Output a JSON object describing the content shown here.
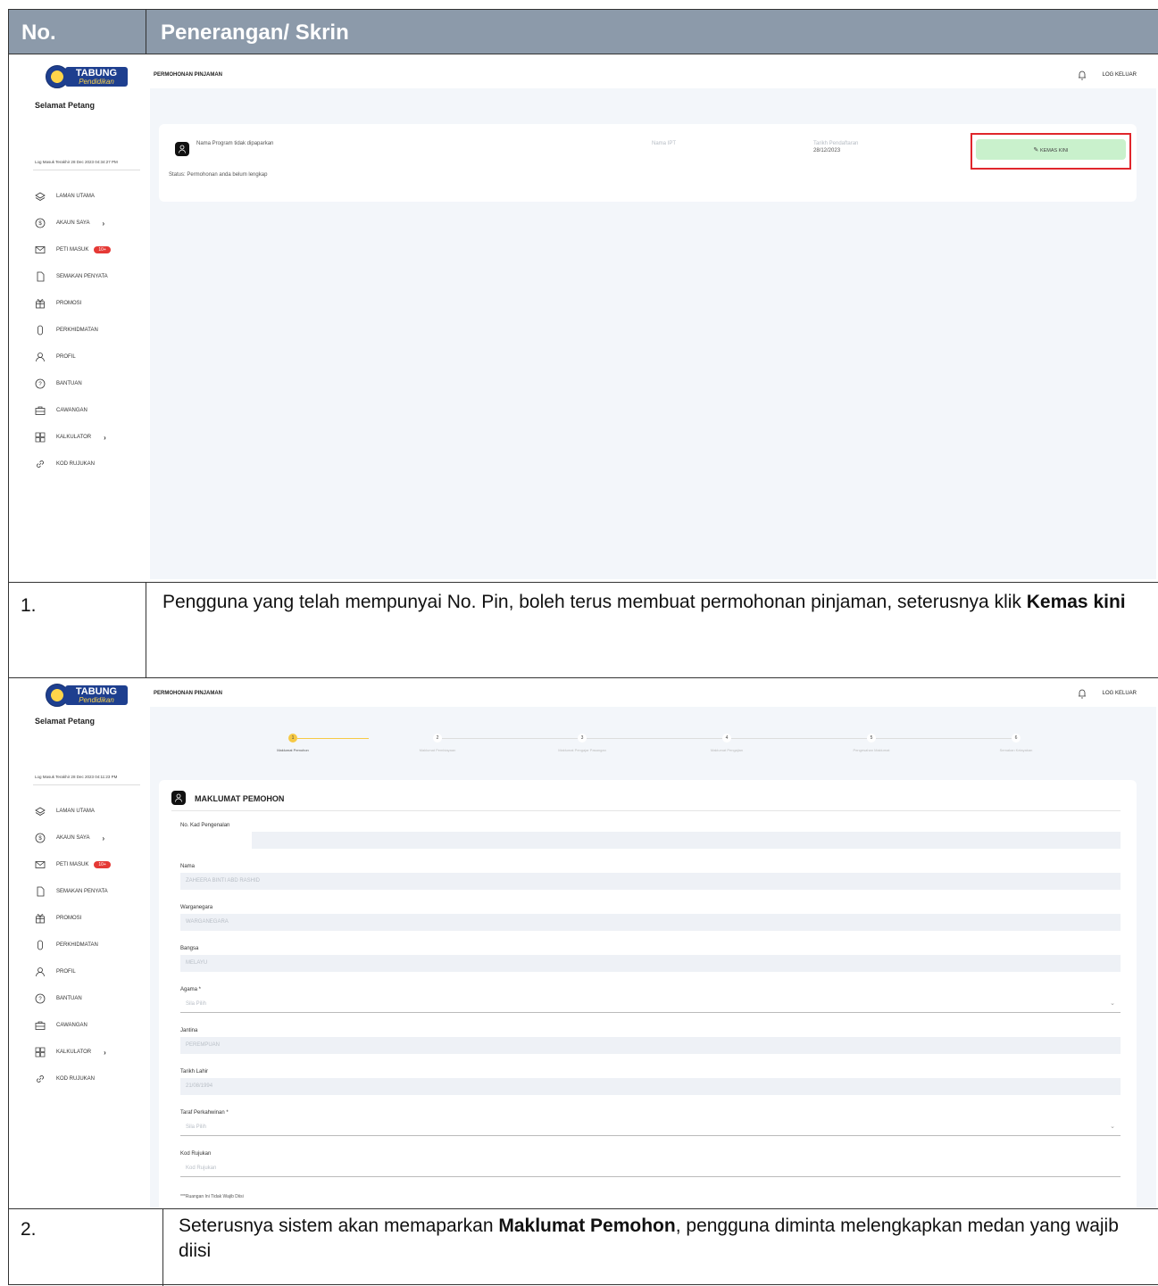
{
  "header": {
    "col1": "No.",
    "col2": "Penerangan/ Skrin"
  },
  "app": {
    "logo_top": "TABUNG",
    "logo_bottom": "Pendidikan",
    "greeting": "Selamat Petang",
    "page_title": "PERMOHONAN PINJAMAN",
    "logout": "LOG KELUAR",
    "nav": [
      {
        "label": "LAMAN UTAMA",
        "icon": "layers-icon"
      },
      {
        "label": "AKAUN SAYA",
        "icon": "dollar-circle-icon",
        "chevron": "›"
      },
      {
        "label": "PETI MASUK",
        "icon": "mail-icon",
        "badge": "10+"
      },
      {
        "label": "SEMAKAN PENYATA",
        "icon": "document-icon"
      },
      {
        "label": "PROMOSI",
        "icon": "gift-icon"
      },
      {
        "label": "PERKHIDMATAN",
        "icon": "mouse-icon"
      },
      {
        "label": "PROFIL",
        "icon": "user-icon"
      },
      {
        "label": "BANTUAN",
        "icon": "help-circle-icon"
      },
      {
        "label": "CAWANGAN",
        "icon": "briefcase-icon"
      },
      {
        "label": "KALKULATOR",
        "icon": "calculator-icon",
        "chevron": "›"
      },
      {
        "label": "KOD RUJUKAN",
        "icon": "link-icon"
      }
    ]
  },
  "shot1": {
    "last_login": "Log Masuk Terakhir 28 Dec 2023 04:34:27 PM",
    "program": "Nama Program tidak dipaparkan",
    "ipt": "Nama IPT",
    "date_label": "Tarikh Pendaftaran",
    "date_value": "28/12/2023",
    "button": "KEMAS KINI",
    "status": "Status: Permohonan anda belum lengkap"
  },
  "row1": {
    "num": "1.",
    "text_a": "Pengguna yang telah mempunyai No. Pin, boleh terus membuat permohonan pinjaman, seterusnya klik ",
    "text_bold": "Kemas kini"
  },
  "shot2": {
    "last_login": "Log Masuk Terakhir 28 Dec 2023 04:11:23 PM",
    "steps": [
      {
        "n": "1",
        "label": "Maklumat Pemohon"
      },
      {
        "n": "2",
        "label": "Maklumat Pembiayaan"
      },
      {
        "n": "3",
        "label": "Maklumat Pengajar Pasangan"
      },
      {
        "n": "4",
        "label": "Maklumat Pengajian"
      },
      {
        "n": "5",
        "label": "Pengesahan Maklumat"
      },
      {
        "n": "6",
        "label": "Semakan Kelayakan"
      }
    ],
    "section_title": "MAKLUMAT PEMOHON",
    "fields": [
      {
        "label": "No. Kad Pengenalan",
        "value": ""
      },
      {
        "label": "Nama",
        "value": "ZAHEERA BINTI ABD RASHID"
      },
      {
        "label": "Warganegara",
        "value": "WARGANEGARA"
      },
      {
        "label": "Bangsa",
        "value": "MELAYU"
      },
      {
        "label": "Agama *",
        "value": "Sila Pilih"
      },
      {
        "label": "Jantina",
        "value": "PEREMPUAN"
      },
      {
        "label": "Tarikh Lahir",
        "value": "21/08/1994"
      },
      {
        "label": "Taraf Perkahwinan *",
        "value": "Sila Pilih"
      },
      {
        "label": "Kod Rujukan",
        "value": "Kod Rujukan"
      }
    ],
    "note": "***Ruangan Ini Tidak Wajib Diisi"
  },
  "row2": {
    "num": "2.",
    "text_a": "Seterusnya sistem akan memaparkan ",
    "text_bold": "Maklumat Pemohon",
    "text_b": ", pengguna diminta melengkapkan medan yang wajib diisi"
  },
  "colors": {
    "header_bg": "#8c9aaa",
    "accent_green": "#c9f1cc",
    "highlight_red": "#e0262c",
    "step_active": "#f6c945"
  }
}
